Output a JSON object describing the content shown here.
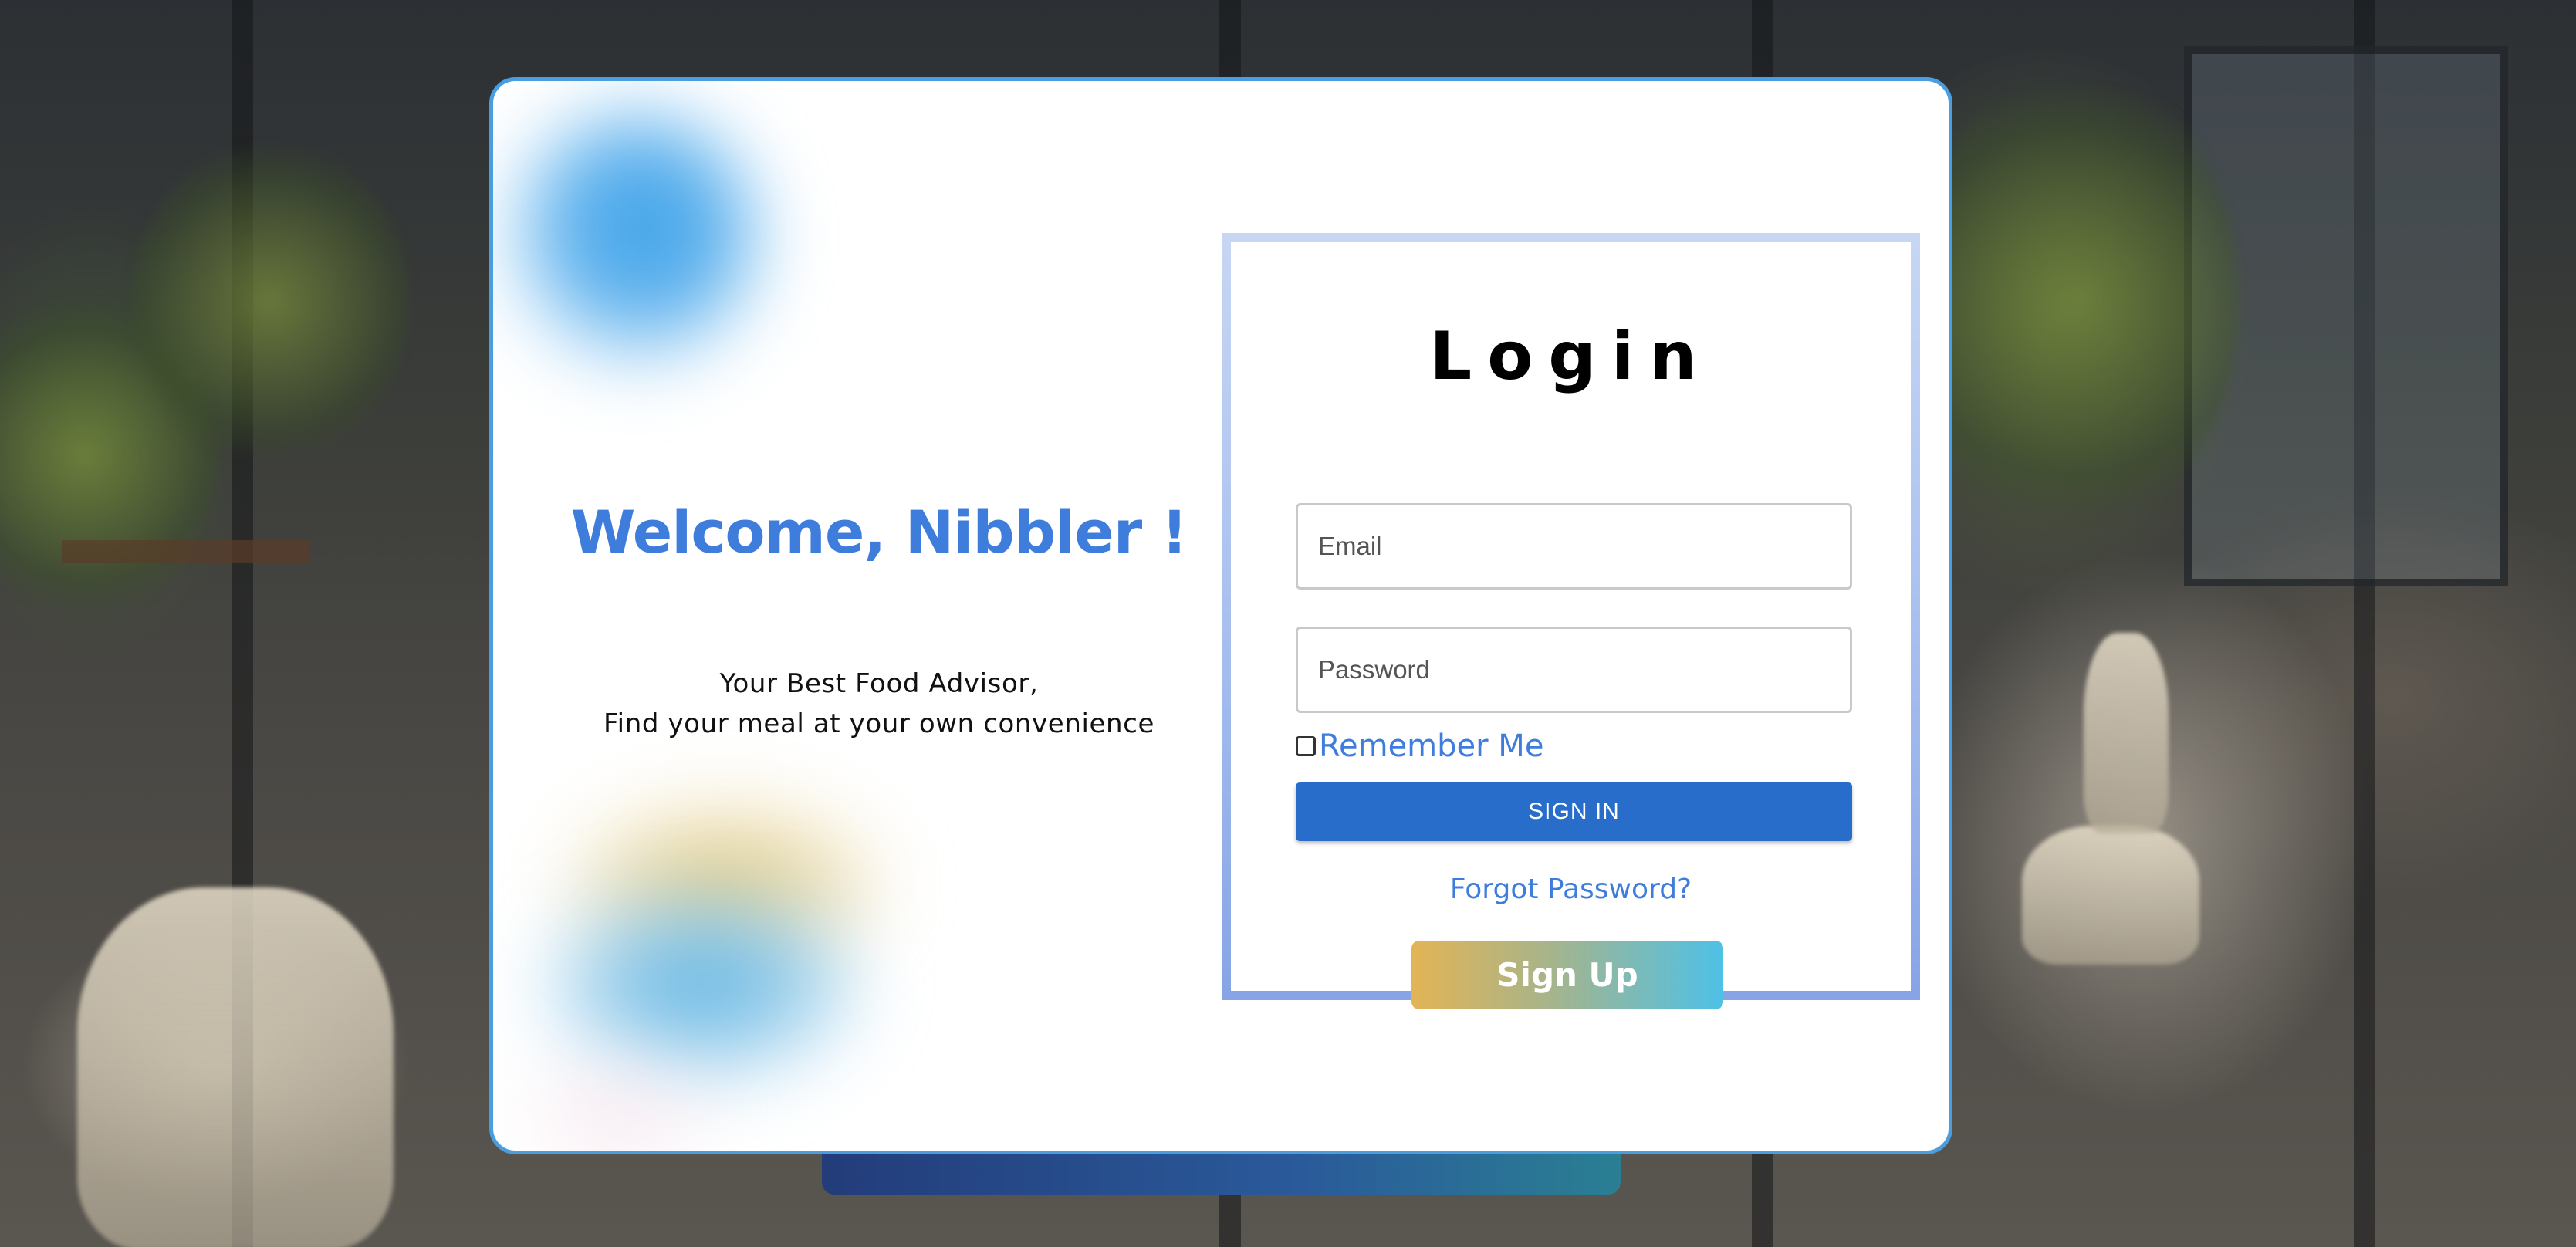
{
  "welcome": {
    "title": "Welcome, Nibbler !",
    "tagline_line1": "Your Best Food Advisor,",
    "tagline_line2": "Find your meal at your own convenience"
  },
  "login": {
    "title": "Login",
    "email_placeholder": "Email",
    "password_placeholder": "Password",
    "remember_label": "Remember Me",
    "signin_label": "SIGN IN",
    "forgot_label": "Forgot Password?",
    "signup_label": "Sign Up",
    "remember_checked": false
  },
  "colors": {
    "accent_blue": "#3f7ddc",
    "signin_blue": "#276dc9",
    "card_border": "#4a9ee0",
    "signup_gradient_start": "#e3b455",
    "signup_gradient_end": "#4ec1e6"
  },
  "icons": {
    "checkbox": "checkbox-unchecked-icon"
  }
}
